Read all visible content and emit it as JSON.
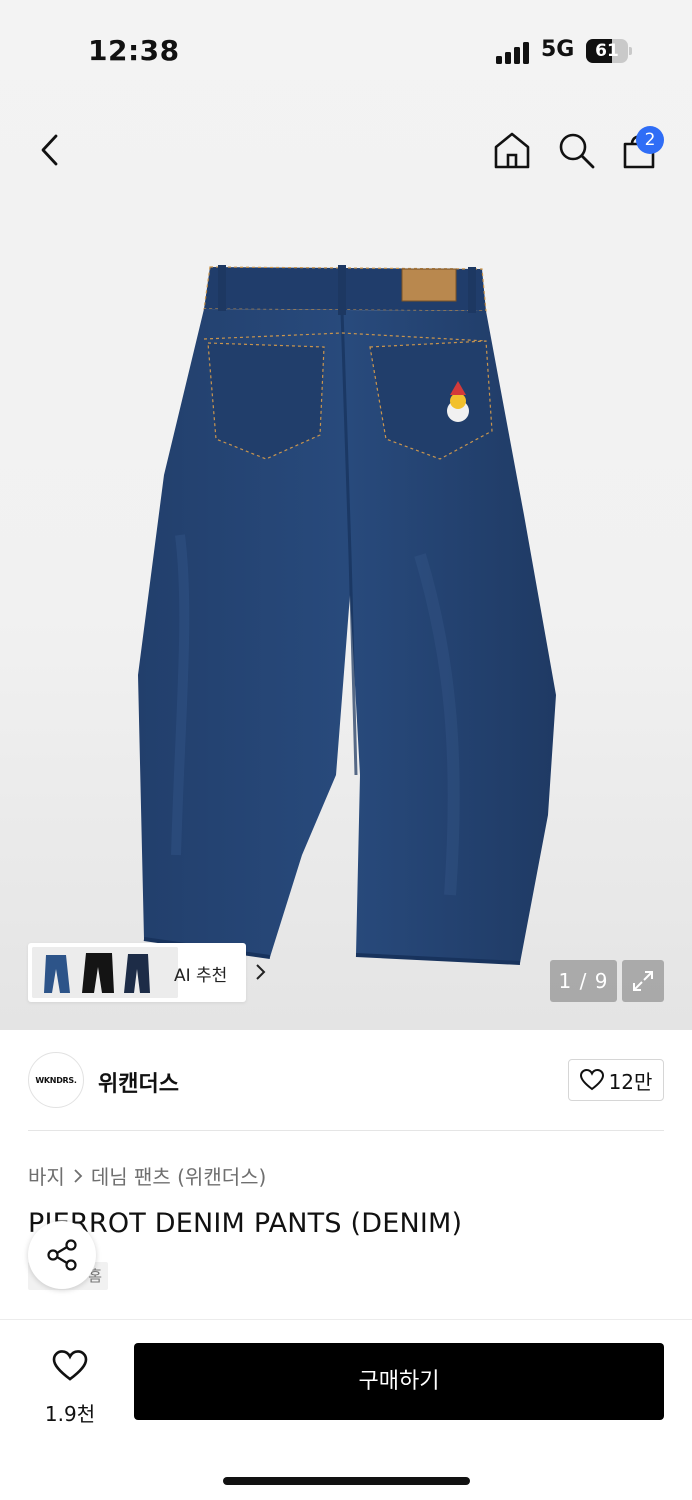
{
  "status_bar": {
    "time": "12:38",
    "network": "5G",
    "battery_level": "61",
    "battery_fraction": 0.61
  },
  "header": {
    "back_icon": "chevron-left-icon",
    "home_icon": "home-icon",
    "search_icon": "search-icon",
    "cart_icon": "shopping-bag-icon",
    "cart_badge": "2",
    "badge_color": "#2f6df6"
  },
  "gallery": {
    "ai_recommend_label": "AI 추천",
    "counter": "1 / 9",
    "expand_icon": "expand-icon"
  },
  "brand": {
    "logo_text": "WKNDRS.",
    "name": "위캔더스",
    "like_count": "12만"
  },
  "product": {
    "breadcrumb": [
      "바지",
      "데님 팬츠 (위캔더스)"
    ],
    "title": "PIERROT DENIM PANTS (DENIM)",
    "tag": "홈"
  },
  "bottom_bar": {
    "wish_count": "1.9천",
    "buy_label": "구매하기"
  },
  "colors": {
    "denim": "#1f3e6e",
    "accent": "#2f6df6",
    "button": "#000000"
  }
}
